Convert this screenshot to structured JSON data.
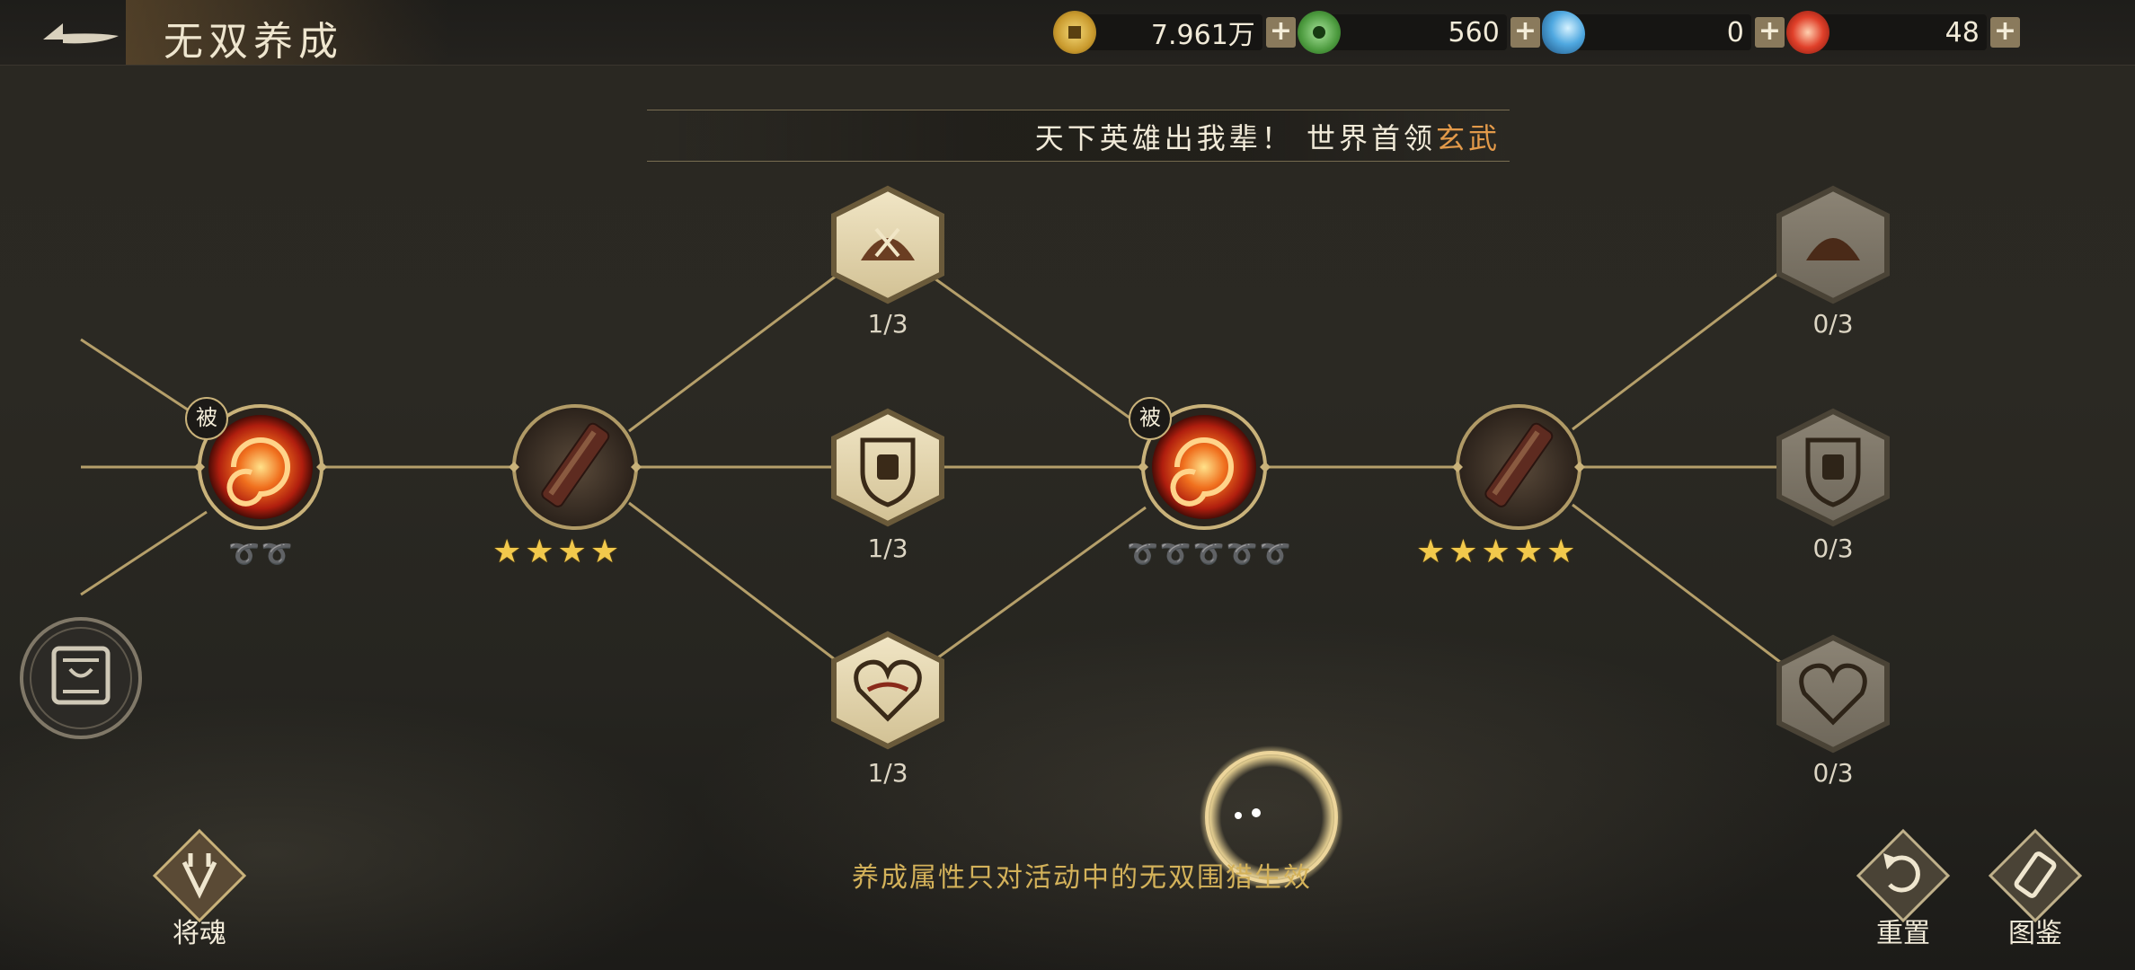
{
  "header": {
    "title": "无双养成",
    "currencies": [
      {
        "icon": "copper-coin-icon",
        "value": "7.961万"
      },
      {
        "icon": "jade-coin-icon",
        "value": "560"
      },
      {
        "icon": "blue-crystal-icon",
        "value": "0"
      },
      {
        "icon": "red-orb-icon",
        "value": "48"
      }
    ],
    "plus_label": "+"
  },
  "banner": {
    "text": "天下英雄出我辈！ 世界首领",
    "highlight": "玄武"
  },
  "nodes": {
    "passive_badge": "被",
    "passive1_rings": "➰➰",
    "weapon1_stars": "★★★★",
    "passive2_rings": "➰➰➰➰➰",
    "weapon2_stars": "★★★★★",
    "attack_left": "1/3",
    "defense_left": "1/3",
    "health_left": "1/3",
    "attack_right": "0/3",
    "defense_right": "0/3",
    "health_right": "0/3"
  },
  "footer": {
    "hint": "养成属性只对活动中的无双围猎生效",
    "soul_label": "将魂",
    "reset_label": "重置",
    "codex_label": "图鉴"
  }
}
